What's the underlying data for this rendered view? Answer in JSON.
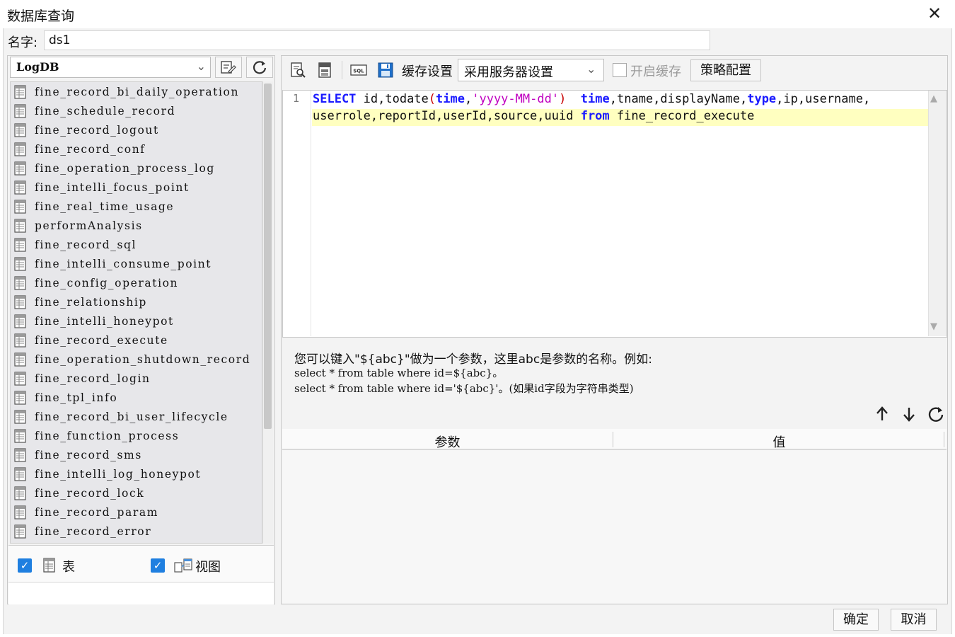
{
  "window": {
    "title": "数据库查询",
    "close_symbol": "✕"
  },
  "name_row": {
    "label": "名字:",
    "value": "ds1"
  },
  "connection": {
    "selected": "LogDB",
    "arrow": "⌄"
  },
  "tables": [
    "fine_record_bi_daily_operation",
    "fine_schedule_record",
    "fine_record_logout",
    "fine_record_conf",
    "fine_operation_process_log",
    "fine_intelli_focus_point",
    "fine_real_time_usage",
    "performAnalysis",
    "fine_record_sql",
    "fine_intelli_consume_point",
    "fine_config_operation",
    "fine_relationship",
    "fine_intelli_honeypot",
    "fine_record_execute",
    "fine_operation_shutdown_record",
    "fine_record_login",
    "fine_tpl_info",
    "fine_record_bi_user_lifecycle",
    "fine_function_process",
    "fine_record_sms",
    "fine_intelli_log_honeypot",
    "fine_record_lock",
    "fine_record_param",
    "fine_record_error"
  ],
  "filters": {
    "table_label": "表",
    "table_checked": true,
    "view_label": "视图",
    "view_checked": true,
    "check_mark": "✓"
  },
  "toolbar": {
    "cache_label": "缓存设置",
    "cache_mode": "采用服务器设置",
    "cache_arrow": "⌄",
    "enable_cache_label": "开启缓存",
    "enable_cache_checked": false,
    "strategy_button": "策略配置",
    "sql_icon_text": "SQL"
  },
  "editor": {
    "line_number": "1",
    "line1": {
      "kw_select": "SELECT",
      "t1": " id,todate",
      "p_open": "(",
      "kw_time": "time",
      "comma": ",",
      "str": "'yyyy-MM-dd'",
      "p_close": ")",
      "sp": "  ",
      "kw_time2": "time",
      "t2": ",tname,displayName,",
      "kw_type": "type",
      "t3": ",ip,username,"
    },
    "line2": {
      "t1": "userrole,reportId,userId,source,uuid ",
      "kw_from": "from",
      "t2": " fine_record_execute"
    },
    "scroll_up": "▲",
    "scroll_down": "▼"
  },
  "hint": {
    "line1": "您可以键入\"${abc}\"做为一个参数，这里abc是参数的名称。例如:",
    "line2": "select * from table where id=${abc}。",
    "line3": "select * from table where id='${abc}'。(如果id字段为字符串类型)"
  },
  "params": {
    "col_param": "参数",
    "col_value": "值",
    "up_symbol": "↑",
    "down_symbol": "↓",
    "refresh_symbol": "↻"
  },
  "footer": {
    "ok": "确定",
    "cancel": "取消"
  },
  "colors": {
    "keyword": "#1a1aff",
    "string": "#c000c0",
    "paren": "#c80000",
    "highlight_line": "#ffffc0",
    "checkbox": "#1f7fe0"
  }
}
